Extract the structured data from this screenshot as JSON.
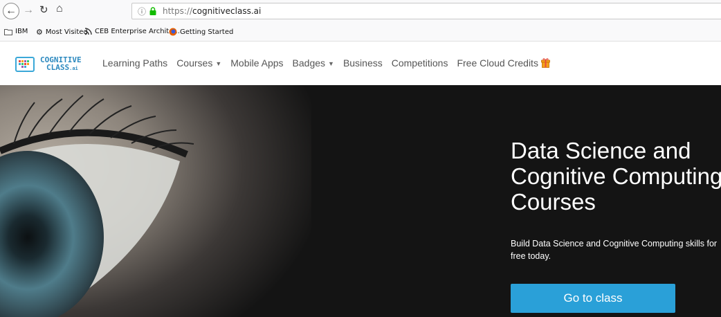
{
  "browser": {
    "url_prefix": "https://",
    "url_domain": "cognitiveclass.ai",
    "bookmarks": [
      {
        "label": "IBM",
        "icon": "folder-icon"
      },
      {
        "label": "Most Visited",
        "icon": "gear-icon"
      },
      {
        "label": "CEB Enterprise Archite...",
        "icon": "rss-icon"
      },
      {
        "label": "Getting Started",
        "icon": "firefox-icon"
      }
    ]
  },
  "site": {
    "logo": {
      "line1": "COGNITIVE",
      "line2": "CLASS",
      "suffix": ".ai"
    },
    "nav": {
      "learning_paths": "Learning Paths",
      "courses": "Courses",
      "mobile_apps": "Mobile Apps",
      "badges": "Badges",
      "business": "Business",
      "competitions": "Competitions",
      "free_cloud_credits": "Free Cloud Credits"
    }
  },
  "hero": {
    "title_line1": "Data Science and",
    "title_line2": "Cognitive Computing",
    "title_line3": "Courses",
    "subtitle": "Build Data Science and Cognitive Computing skills for free today.",
    "cta_label": "Go to class"
  },
  "colors": {
    "accent": "#2aa0d8",
    "logo": "#2c89bf",
    "gift": "#f4a21a"
  }
}
